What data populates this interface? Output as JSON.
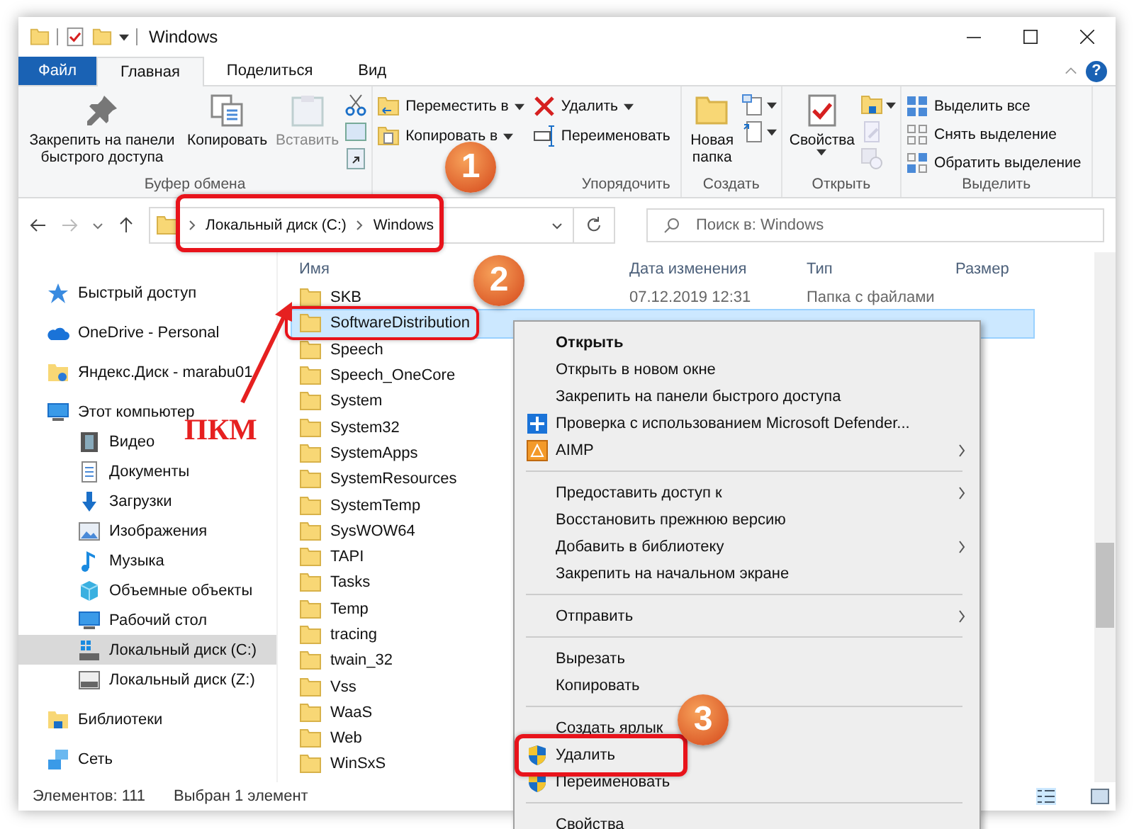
{
  "window": {
    "title": "Windows",
    "help_button": "?"
  },
  "ribbon": {
    "tabs": [
      {
        "label": "Файл",
        "kind": "file",
        "selected": false
      },
      {
        "label": "Главная",
        "kind": "tab",
        "selected": true
      },
      {
        "label": "Поделиться",
        "kind": "tab",
        "selected": false
      },
      {
        "label": "Вид",
        "kind": "tab",
        "selected": false
      }
    ],
    "groups": [
      {
        "label": "Буфер обмена",
        "columns": [
          [
            {
              "kind": "large",
              "label": "Закрепить на панели быстрого доступа",
              "dropdown": false,
              "disabled": false
            }
          ],
          [
            {
              "kind": "large",
              "label": "Копировать",
              "dropdown": false,
              "disabled": false
            }
          ],
          [
            {
              "kind": "large",
              "label": "Вставить",
              "dropdown": false,
              "disabled": true
            }
          ],
          [
            {
              "kind": "icon",
              "dropdown": false,
              "disabled": false
            },
            {
              "kind": "icon",
              "dropdown": false,
              "disabled": false
            },
            {
              "kind": "icon",
              "dropdown": false,
              "disabled": false
            }
          ]
        ]
      },
      {
        "label": "Упорядочить",
        "columns": [
          [
            {
              "kind": "small",
              "label": "Переместить в",
              "dropdown": true,
              "disabled": false
            },
            {
              "kind": "small",
              "label": "Копировать в",
              "dropdown": true,
              "disabled": false
            }
          ],
          [
            {
              "kind": "small",
              "label": "Удалить",
              "dropdown": true,
              "disabled": false
            },
            {
              "kind": "small",
              "label": "Переименовать",
              "dropdown": false,
              "disabled": false
            }
          ]
        ]
      },
      {
        "label": "Создать",
        "columns": [
          [
            {
              "kind": "large",
              "label": "Новая папка",
              "dropdown": false,
              "disabled": false
            }
          ],
          [
            {
              "kind": "icon",
              "dropdown": true,
              "disabled": false
            },
            {
              "kind": "icon",
              "dropdown": true,
              "disabled": false
            }
          ]
        ]
      },
      {
        "label": "Открыть",
        "columns": [
          [
            {
              "kind": "large",
              "label": "Свойства",
              "dropdown": true,
              "disabled": false
            }
          ],
          [
            {
              "kind": "icon",
              "dropdown": true,
              "disabled": false
            },
            {
              "kind": "icon",
              "dropdown": false,
              "disabled": true
            },
            {
              "kind": "icon",
              "dropdown": false,
              "disabled": true
            }
          ]
        ]
      },
      {
        "label": "Выделить",
        "columns": [
          [
            {
              "kind": "small",
              "label": "Выделить все",
              "dropdown": false,
              "disabled": false
            },
            {
              "kind": "small",
              "label": "Снять выделение",
              "dropdown": false,
              "disabled": false
            },
            {
              "kind": "small",
              "label": "Обратить выделение",
              "dropdown": false,
              "disabled": false
            }
          ]
        ]
      }
    ]
  },
  "address": {
    "path": [
      "Локальный диск (C:)",
      "Windows"
    ],
    "search_placeholder": "Поиск в: Windows"
  },
  "sidebar": {
    "items": [
      {
        "label": "Быстрый доступ",
        "selected": false
      },
      {
        "label": "OneDrive - Personal",
        "selected": false
      },
      {
        "label": "Яндекс.Диск - marabu01",
        "selected": false
      },
      {
        "label": "Этот компьютер",
        "selected": false,
        "children": [
          {
            "label": "Видео",
            "selected": false
          },
          {
            "label": "Документы",
            "selected": false
          },
          {
            "label": "Загрузки",
            "selected": false
          },
          {
            "label": "Изображения",
            "selected": false
          },
          {
            "label": "Музыка",
            "selected": false
          },
          {
            "label": "Объемные объекты",
            "selected": false
          },
          {
            "label": "Рабочий стол",
            "selected": false
          },
          {
            "label": "Локальный диск (C:)",
            "selected": true
          },
          {
            "label": "Локальный диск (Z:)",
            "selected": false
          }
        ]
      },
      {
        "label": "Библиотеки",
        "selected": false
      },
      {
        "label": "Сеть",
        "selected": false
      }
    ]
  },
  "table": {
    "columns": [
      "Имя",
      "Дата изменения",
      "Тип",
      "Размер"
    ],
    "rows": [
      {
        "name": "SKB",
        "date": "07.12.2019 12:31",
        "type": "Папка с файлами",
        "selected": false
      },
      {
        "name": "SoftwareDistribution",
        "selected": true
      },
      {
        "name": "Speech",
        "selected": false
      },
      {
        "name": "Speech_OneCore",
        "selected": false
      },
      {
        "name": "System",
        "selected": false
      },
      {
        "name": "System32",
        "selected": false
      },
      {
        "name": "SystemApps",
        "selected": false
      },
      {
        "name": "SystemResources",
        "selected": false
      },
      {
        "name": "SystemTemp",
        "selected": false
      },
      {
        "name": "SysWOW64",
        "selected": false
      },
      {
        "name": "TAPI",
        "selected": false
      },
      {
        "name": "Tasks",
        "selected": false
      },
      {
        "name": "Temp",
        "selected": false
      },
      {
        "name": "tracing",
        "selected": false
      },
      {
        "name": "twain_32",
        "selected": false
      },
      {
        "name": "Vss",
        "selected": false
      },
      {
        "name": "WaaS",
        "selected": false
      },
      {
        "name": "Web",
        "selected": false
      },
      {
        "name": "WinSxS",
        "selected": false
      }
    ]
  },
  "context_menu": [
    {
      "kind": "item",
      "label": "Открыть",
      "default": true,
      "submenu": false
    },
    {
      "kind": "item",
      "label": "Открыть в новом окне",
      "default": false,
      "submenu": false
    },
    {
      "kind": "item",
      "label": "Закрепить на панели быстрого доступа",
      "default": false,
      "submenu": false
    },
    {
      "kind": "item",
      "label": "Проверка с использованием Microsoft Defender...",
      "default": false,
      "submenu": false
    },
    {
      "kind": "item",
      "label": "AIMP",
      "default": false,
      "submenu": true
    },
    {
      "kind": "separator"
    },
    {
      "kind": "item",
      "label": "Предоставить доступ к",
      "default": false,
      "submenu": true
    },
    {
      "kind": "item",
      "label": "Восстановить прежнюю версию",
      "default": false,
      "submenu": false
    },
    {
      "kind": "item",
      "label": "Добавить в библиотеку",
      "default": false,
      "submenu": true
    },
    {
      "kind": "item",
      "label": "Закрепить на начальном экране",
      "default": false,
      "submenu": false
    },
    {
      "kind": "separator"
    },
    {
      "kind": "item",
      "label": "Отправить",
      "default": false,
      "submenu": true
    },
    {
      "kind": "separator"
    },
    {
      "kind": "item",
      "label": "Вырезать",
      "default": false,
      "submenu": false
    },
    {
      "kind": "item",
      "label": "Копировать",
      "default": false,
      "submenu": false
    },
    {
      "kind": "separator"
    },
    {
      "kind": "item",
      "label": "Создать ярлык",
      "default": false,
      "submenu": false
    },
    {
      "kind": "item",
      "label": "Удалить",
      "default": false,
      "submenu": false
    },
    {
      "kind": "item",
      "label": "Переименовать",
      "default": false,
      "submenu": false
    },
    {
      "kind": "separator"
    },
    {
      "kind": "item",
      "label": "Свойства",
      "default": false,
      "submenu": false
    }
  ],
  "status_bar": {
    "items": [
      "Элементов: 111",
      "Выбран 1 элемент"
    ]
  },
  "annotations": {
    "steps": [
      "1",
      "2",
      "3"
    ],
    "label": "ПКМ"
  }
}
